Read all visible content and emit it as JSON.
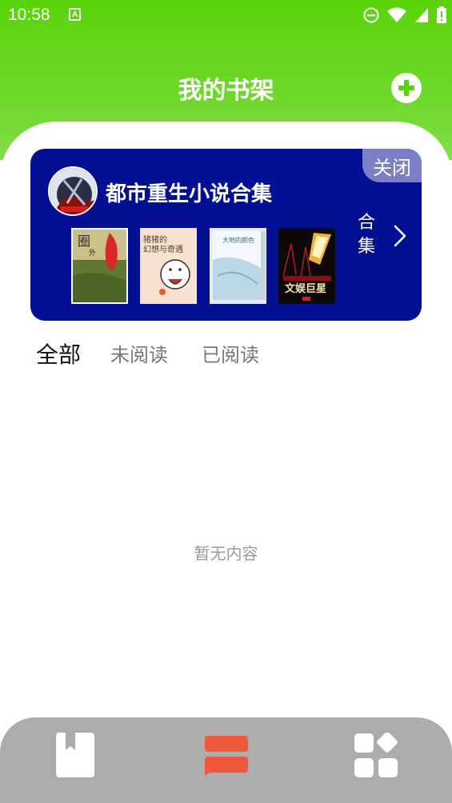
{
  "status_bar": {
    "time": "10:58",
    "notification_icon": "A"
  },
  "header": {
    "title": "我的书架",
    "add_icon": "plus-circle-icon"
  },
  "collection": {
    "title": "都市重生小说合集",
    "close_label": "关闭",
    "link_label": "合集",
    "bg_color": "#021091",
    "books": [
      {
        "cover_title": "圈外",
        "cover_colors": [
          "#5a7a2e",
          "#c8b87a"
        ]
      },
      {
        "cover_title": "猪猪的幻想与奇遇",
        "cover_colors": [
          "#f6ddc8",
          "#f0c8a8"
        ]
      },
      {
        "cover_title": "大地的颜色",
        "cover_colors": [
          "#dfeef4",
          "#b8d6e4"
        ]
      },
      {
        "cover_title": "文娱巨星",
        "cover_colors": [
          "#1a0c08",
          "#e09030"
        ]
      }
    ]
  },
  "tabs": [
    {
      "label": "全部",
      "active": true
    },
    {
      "label": "未阅读",
      "active": false
    },
    {
      "label": "已阅读",
      "active": false
    }
  ],
  "empty_state": "暂无内容",
  "bottom_nav": [
    {
      "name": "bookshelf-icon",
      "active": false
    },
    {
      "name": "library-icon",
      "active": true
    },
    {
      "name": "apps-grid-icon",
      "active": false
    }
  ],
  "colors": {
    "brand_green": "#5ad40a",
    "accent_orange": "#f0583c",
    "nav_bg": "#acacac"
  }
}
